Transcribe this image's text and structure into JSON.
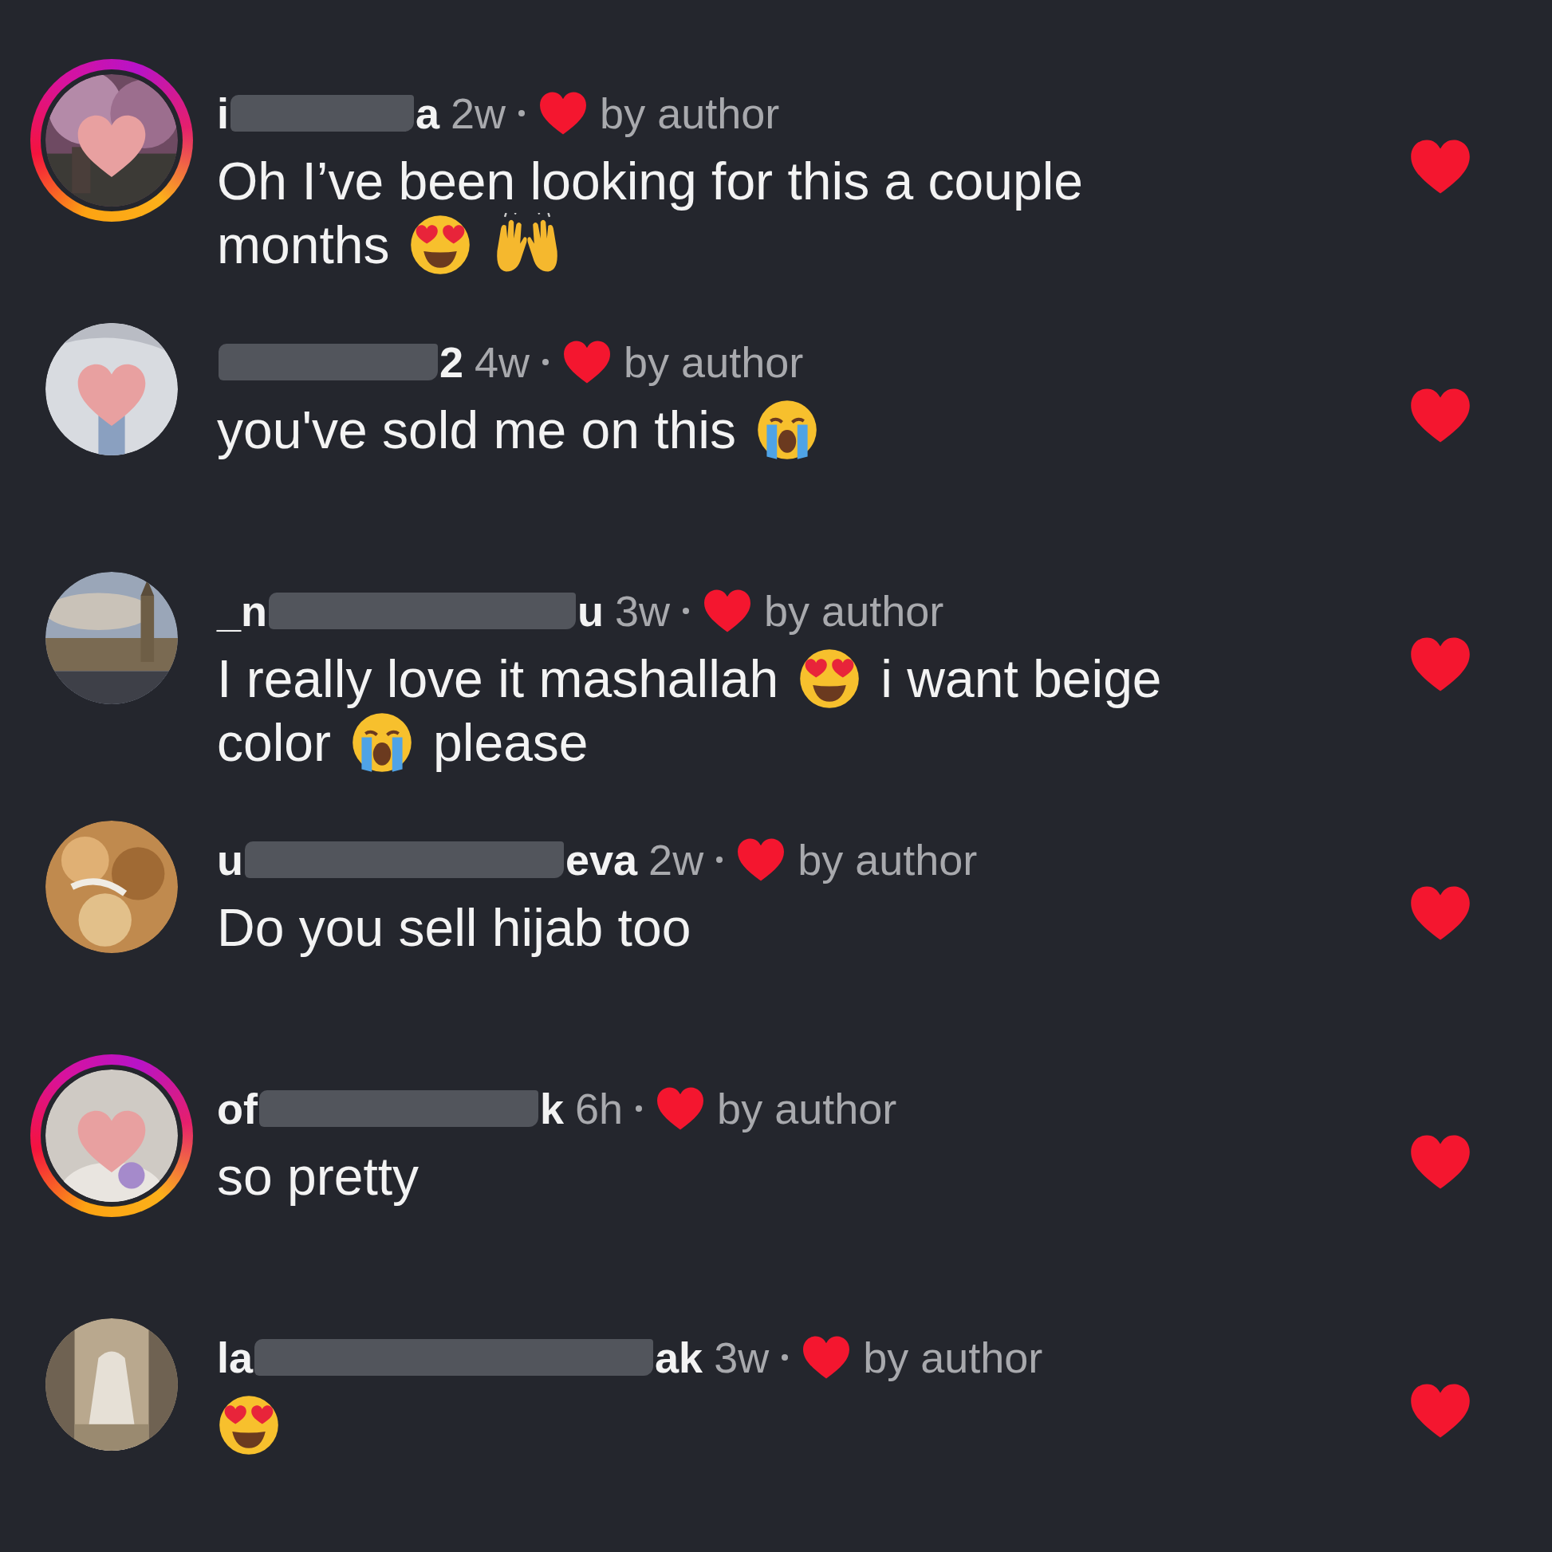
{
  "comments": [
    {
      "avatar": {
        "kind": "picture",
        "story_ring": true,
        "sticker": true
      },
      "username_start": "i",
      "username_end": "a",
      "time": "2w",
      "author_liked": true,
      "author_label": "by author",
      "liked": true,
      "lines": [
        [
          {
            "kind": "text",
            "text": "Oh I’ve been looking for this a couple"
          }
        ],
        [
          {
            "kind": "text",
            "text": "months"
          },
          {
            "kind": "heart_eyes"
          },
          {
            "kind": "raised_hands"
          }
        ]
      ]
    },
    {
      "avatar": {
        "kind": "picture",
        "story_ring": false,
        "sticker": true
      },
      "username_end": "2",
      "time": "4w",
      "author_liked": true,
      "author_label": "by author",
      "liked": true,
      "lines": [
        [
          {
            "kind": "text",
            "text": "you've sold me on this"
          },
          {
            "kind": "crying"
          }
        ]
      ]
    },
    {
      "avatar": {
        "kind": "picture",
        "story_ring": false,
        "sticker": false
      },
      "username_start": "_n",
      "username_end": "u",
      "time": "3w",
      "author_liked": true,
      "author_label": "by author",
      "liked": true,
      "lines": [
        [
          {
            "kind": "text",
            "text": "I really love it mashallah"
          },
          {
            "kind": "heart_eyes"
          },
          {
            "kind": "text",
            "text": "i want beige"
          }
        ],
        [
          {
            "kind": "text",
            "text": "color"
          },
          {
            "kind": "crying"
          },
          {
            "kind": "text",
            "text": "please"
          }
        ]
      ]
    },
    {
      "avatar": {
        "kind": "picture",
        "story_ring": false,
        "sticker": false
      },
      "username_start": "u",
      "username_end": "eva",
      "time": "2w",
      "author_liked": true,
      "author_label": "by author",
      "liked": true,
      "lines": [
        [
          {
            "kind": "text",
            "text": "Do you sell hijab too"
          }
        ]
      ]
    },
    {
      "avatar": {
        "kind": "picture",
        "story_ring": true,
        "sticker": true
      },
      "username_start": "of",
      "username_end": "k",
      "time": "6h",
      "author_liked": true,
      "author_label": "by author",
      "liked": true,
      "lines": [
        [
          {
            "kind": "text",
            "text": "so pretty"
          }
        ]
      ]
    },
    {
      "avatar": {
        "kind": "picture",
        "story_ring": false,
        "sticker": false
      },
      "username_start": "la",
      "username_end": "ak",
      "time": "3w",
      "author_liked": true,
      "author_label": "by author",
      "liked": true,
      "lines": [
        [
          {
            "kind": "heart_eyes"
          }
        ]
      ]
    }
  ]
}
